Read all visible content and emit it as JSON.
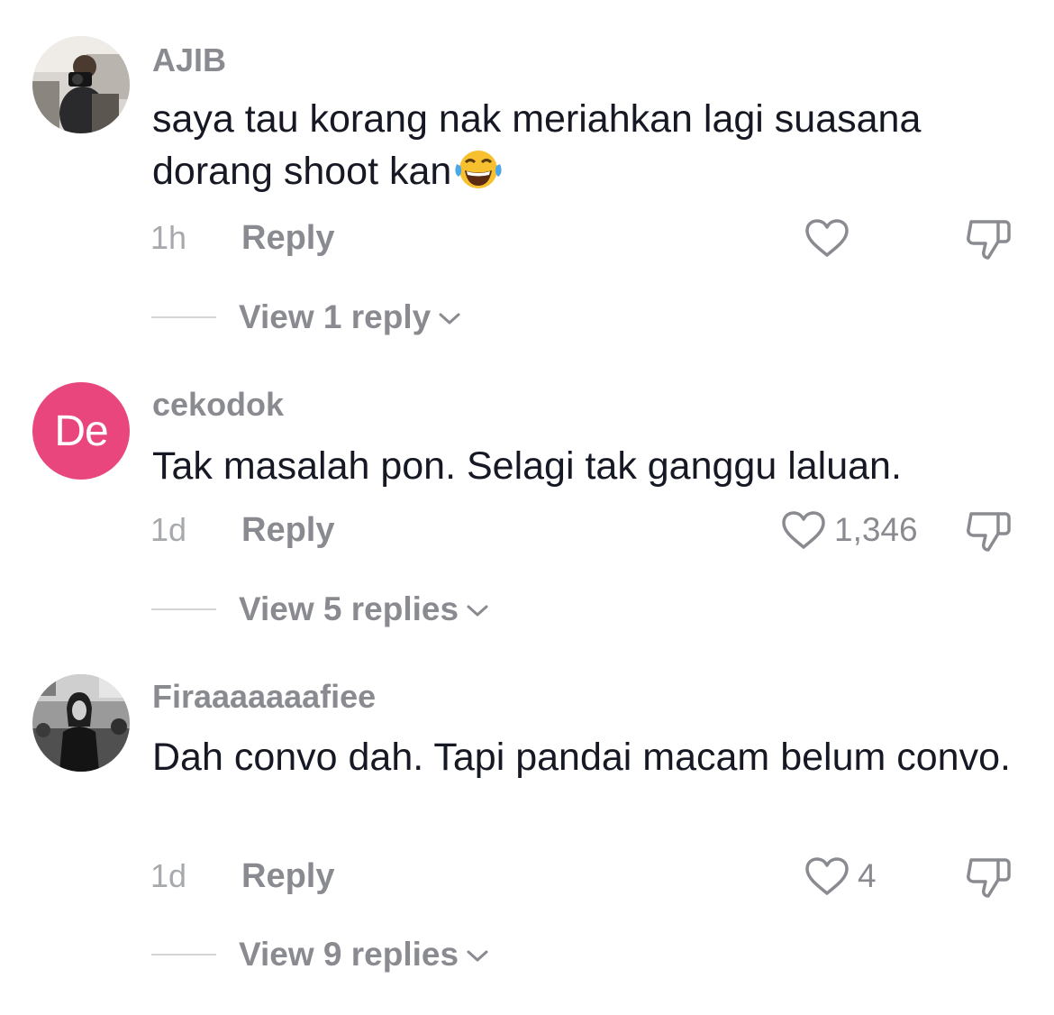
{
  "comments": [
    {
      "username": "AJIB",
      "text": "saya tau korang nak meriahkan lagi suasana dorang shoot kan",
      "emoji": "😂",
      "time": "1h",
      "reply_label": "Reply",
      "likes": "",
      "view_replies": "View 1 reply",
      "avatar": "photo-person-with-camera"
    },
    {
      "username": "cekodok",
      "text": "Tak masalah pon. Selagi tak ganggu laluan.",
      "time": "1d",
      "reply_label": "Reply",
      "likes": "1,346",
      "view_replies": "View 5 replies",
      "avatar_initials": "De",
      "avatar_color": "#e8467c"
    },
    {
      "username": "Firaaaaaaafiee",
      "text": "Dah convo dah. Tapi pandai macam belum convo.",
      "time": "1d",
      "reply_label": "Reply",
      "likes": "4",
      "view_replies": "View 9 replies",
      "avatar": "photo-black-and-white-person"
    }
  ],
  "icons": {
    "like": "heart-outline-icon",
    "dislike": "thumbs-down-outline-icon",
    "expand": "chevron-down-icon"
  },
  "colors": {
    "username": "#8a8b91",
    "text": "#161823",
    "muted": "#a8a9ad",
    "avatar_initials_bg": "#e8467c"
  }
}
